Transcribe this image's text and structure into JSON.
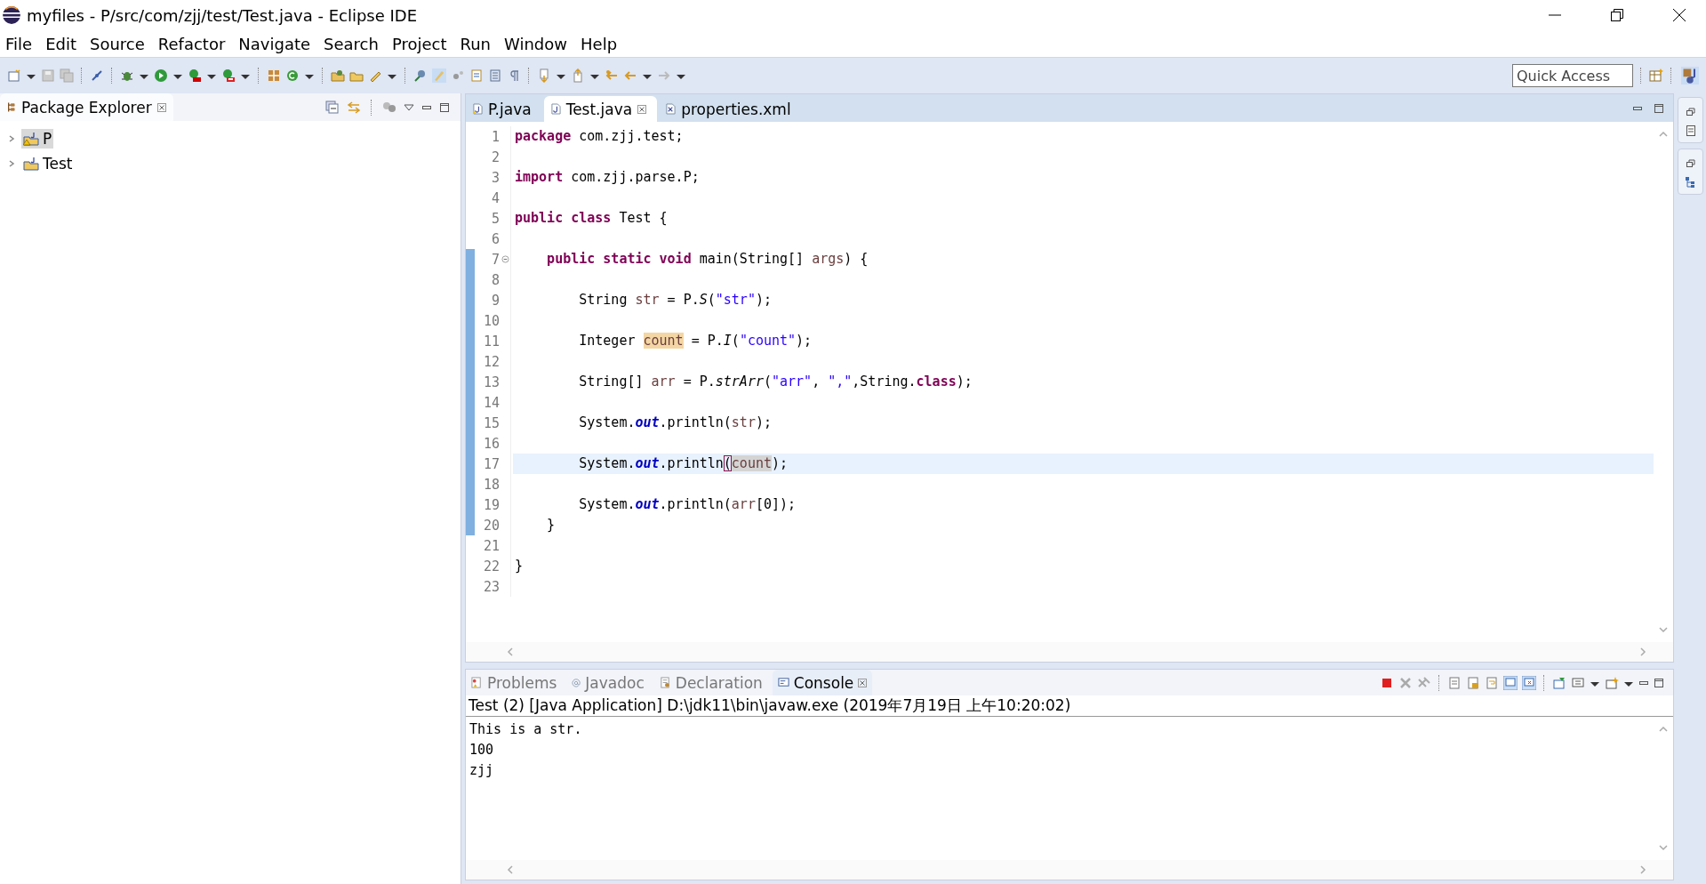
{
  "window": {
    "title": "myfiles - P/src/com/zjj/test/Test.java - Eclipse IDE"
  },
  "menu": [
    "File",
    "Edit",
    "Source",
    "Refactor",
    "Navigate",
    "Search",
    "Project",
    "Run",
    "Window",
    "Help"
  ],
  "quick_access": {
    "placeholder": "Quick Access"
  },
  "package_explorer": {
    "title": "Package Explorer",
    "items": [
      {
        "label": "P",
        "selected": true,
        "warning": true
      },
      {
        "label": "Test",
        "selected": false,
        "warning": false
      }
    ]
  },
  "editor_tabs": [
    {
      "label": "P.java",
      "selected": false,
      "kind": "java"
    },
    {
      "label": "Test.java",
      "selected": true,
      "kind": "java"
    },
    {
      "label": "properties.xml",
      "selected": false,
      "kind": "xml"
    }
  ],
  "code_lines": [
    {
      "number": "1",
      "current": false,
      "changed": false,
      "tokens": [
        {
          "kind": "keyword",
          "text": "package"
        },
        {
          "kind": "plain",
          "text": " com.zjj.test;"
        }
      ]
    },
    {
      "number": "2",
      "current": false,
      "changed": false
    },
    {
      "number": "3",
      "current": false,
      "changed": false,
      "tokens": [
        {
          "kind": "keyword",
          "text": "import"
        },
        {
          "kind": "plain",
          "text": " com.zjj.parse.P;"
        }
      ]
    },
    {
      "number": "4",
      "current": false,
      "changed": false
    },
    {
      "number": "5",
      "current": false,
      "changed": false,
      "tokens": [
        {
          "kind": "keyword",
          "text": "public "
        },
        {
          "kind": "keyword",
          "text": "class"
        },
        {
          "kind": "plain",
          "text": " Test {"
        }
      ]
    },
    {
      "number": "6",
      "current": false,
      "changed": false
    },
    {
      "number": "7",
      "current": false,
      "changed": true,
      "foldable": true,
      "tokens": [
        {
          "kind": "keyword",
          "text": "    public "
        },
        {
          "kind": "keyword",
          "text": "static "
        },
        {
          "kind": "keyword",
          "text": "void"
        },
        {
          "kind": "plain",
          "text": " main(String[] "
        },
        {
          "kind": "variable",
          "text": "args"
        },
        {
          "kind": "plain",
          "text": ") {"
        }
      ]
    },
    {
      "number": "8",
      "current": false,
      "changed": true
    },
    {
      "number": "9",
      "current": false,
      "changed": true,
      "tokens": [
        {
          "kind": "plain",
          "text": "        String "
        },
        {
          "kind": "variable",
          "text": "str"
        },
        {
          "kind": "plain",
          "text": " = P."
        },
        {
          "kind": "static",
          "text": "S"
        },
        {
          "kind": "plain",
          "text": "("
        },
        {
          "kind": "string",
          "text": "\"str\""
        },
        {
          "kind": "plain",
          "text": ");"
        }
      ]
    },
    {
      "number": "10",
      "current": false,
      "changed": true
    },
    {
      "number": "11",
      "current": false,
      "changed": true,
      "tokens": [
        {
          "kind": "plain",
          "text": "        Integer "
        },
        {
          "kind": "write-occurrence",
          "text": "count"
        },
        {
          "kind": "plain",
          "text": " = P."
        },
        {
          "kind": "static",
          "text": "I"
        },
        {
          "kind": "plain",
          "text": "("
        },
        {
          "kind": "string",
          "text": "\"count\""
        },
        {
          "kind": "plain",
          "text": ");"
        }
      ]
    },
    {
      "number": "12",
      "current": false,
      "changed": true
    },
    {
      "number": "13",
      "current": false,
      "changed": true,
      "tokens": [
        {
          "kind": "plain",
          "text": "        String[] "
        },
        {
          "kind": "variable",
          "text": "arr"
        },
        {
          "kind": "plain",
          "text": " = P."
        },
        {
          "kind": "static",
          "text": "strArr"
        },
        {
          "kind": "plain",
          "text": "("
        },
        {
          "kind": "string",
          "text": "\"arr\""
        },
        {
          "kind": "plain",
          "text": ", "
        },
        {
          "kind": "string",
          "text": "\",\""
        },
        {
          "kind": "plain",
          "text": ",String."
        },
        {
          "kind": "keyword",
          "text": "class"
        },
        {
          "kind": "plain",
          "text": ");"
        }
      ]
    },
    {
      "number": "14",
      "current": false,
      "changed": true
    },
    {
      "number": "15",
      "current": false,
      "changed": true,
      "tokens": [
        {
          "kind": "plain",
          "text": "        System."
        },
        {
          "kind": "field",
          "text": "out"
        },
        {
          "kind": "plain",
          "text": ".println("
        },
        {
          "kind": "variable",
          "text": "str"
        },
        {
          "kind": "plain",
          "text": ");"
        }
      ]
    },
    {
      "number": "16",
      "current": false,
      "changed": true
    },
    {
      "number": "17",
      "current": true,
      "changed": true,
      "tokens": [
        {
          "kind": "plain",
          "text": "        System."
        },
        {
          "kind": "field",
          "text": "out"
        },
        {
          "kind": "plain",
          "text": ".println"
        },
        {
          "kind": "bracket",
          "text": "("
        },
        {
          "kind": "read-occurrence",
          "text": "count"
        },
        {
          "kind": "plain",
          "text": ");"
        }
      ]
    },
    {
      "number": "18",
      "current": false,
      "changed": true
    },
    {
      "number": "19",
      "current": false,
      "changed": true,
      "tokens": [
        {
          "kind": "plain",
          "text": "        System."
        },
        {
          "kind": "field",
          "text": "out"
        },
        {
          "kind": "plain",
          "text": ".println("
        },
        {
          "kind": "variable",
          "text": "arr"
        },
        {
          "kind": "plain",
          "text": "[0]);"
        }
      ]
    },
    {
      "number": "20",
      "current": false,
      "changed": true,
      "tokens": [
        {
          "kind": "plain",
          "text": "    }"
        }
      ]
    },
    {
      "number": "21",
      "current": false,
      "changed": false
    },
    {
      "number": "22",
      "current": false,
      "changed": false,
      "tokens": [
        {
          "kind": "plain",
          "text": "}"
        }
      ]
    },
    {
      "number": "23",
      "current": false,
      "changed": false
    }
  ],
  "console_tabs": [
    {
      "label": "Problems",
      "selected": false,
      "kind": "problems"
    },
    {
      "label": "Javadoc",
      "selected": false,
      "kind": "javadoc"
    },
    {
      "label": "Declaration",
      "selected": false,
      "kind": "declaration"
    },
    {
      "label": "Console",
      "selected": true,
      "kind": "console"
    }
  ],
  "console": {
    "header": "Test (2) [Java Application] D:\\jdk11\\bin\\javaw.exe (2019年7月19日 上午10:20:02)",
    "output": [
      "This is a str.",
      "100",
      "zjj"
    ]
  }
}
